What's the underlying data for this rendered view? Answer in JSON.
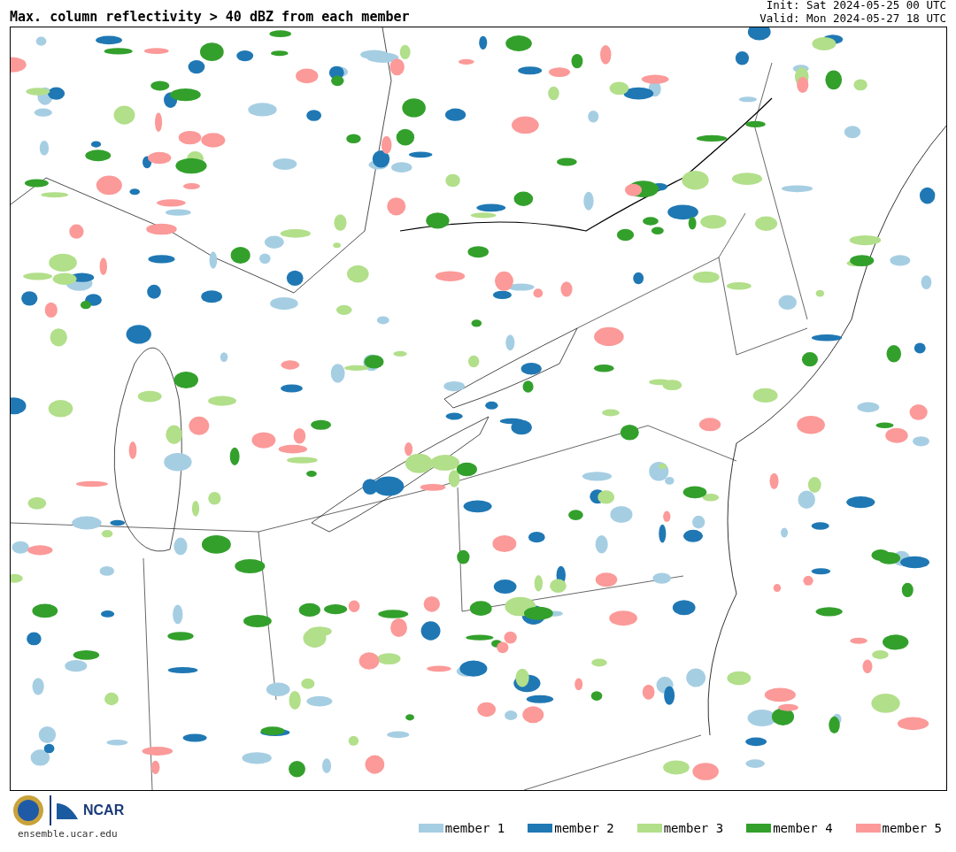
{
  "title": "Max. column reflectivity > 40 dBZ from each member",
  "init": "Init: Sat 2024-05-25 00 UTC",
  "valid": "Valid: Mon 2024-05-27 18 UTC",
  "logo": {
    "text": "NCAR"
  },
  "site": "ensemble.ucar.edu",
  "legend": [
    {
      "label": "member 1",
      "color": "#a6cee3"
    },
    {
      "label": "member 2",
      "color": "#1f78b4"
    },
    {
      "label": "member 3",
      "color": "#b2df8a"
    },
    {
      "label": "member 4",
      "color": "#33a02c"
    },
    {
      "label": "member 5",
      "color": "#fb9a99"
    }
  ]
}
